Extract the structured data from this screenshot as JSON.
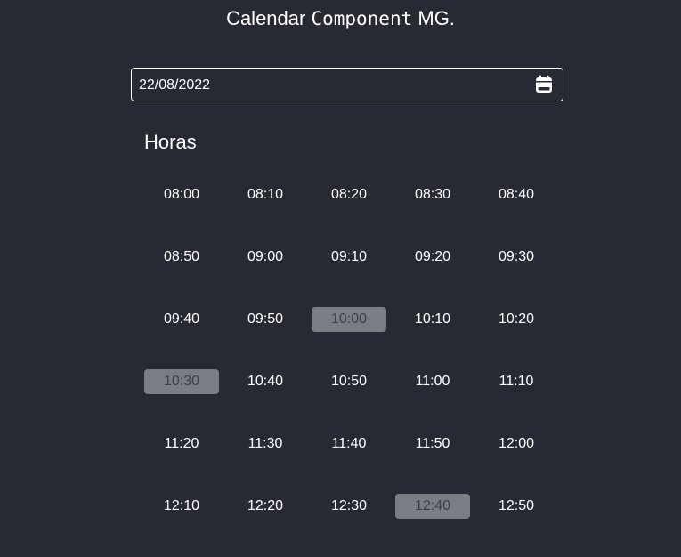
{
  "header": {
    "title_part1": "Calendar ",
    "title_part2": "Component",
    "title_part3": " MG."
  },
  "date_input": {
    "value": "22/08/2022",
    "icon": "calendar-icon"
  },
  "hours": {
    "label": "Horas",
    "slots": [
      {
        "time": "08:00",
        "selected": false
      },
      {
        "time": "08:10",
        "selected": false
      },
      {
        "time": "08:20",
        "selected": false
      },
      {
        "time": "08:30",
        "selected": false
      },
      {
        "time": "08:40",
        "selected": false
      },
      {
        "time": "08:50",
        "selected": false
      },
      {
        "time": "09:00",
        "selected": false
      },
      {
        "time": "09:10",
        "selected": false
      },
      {
        "time": "09:20",
        "selected": false
      },
      {
        "time": "09:30",
        "selected": false
      },
      {
        "time": "09:40",
        "selected": false
      },
      {
        "time": "09:50",
        "selected": false
      },
      {
        "time": "10:00",
        "selected": true
      },
      {
        "time": "10:10",
        "selected": false
      },
      {
        "time": "10:20",
        "selected": false
      },
      {
        "time": "10:30",
        "selected": true
      },
      {
        "time": "10:40",
        "selected": false
      },
      {
        "time": "10:50",
        "selected": false
      },
      {
        "time": "11:00",
        "selected": false
      },
      {
        "time": "11:10",
        "selected": false
      },
      {
        "time": "11:20",
        "selected": false
      },
      {
        "time": "11:30",
        "selected": false
      },
      {
        "time": "11:40",
        "selected": false
      },
      {
        "time": "11:50",
        "selected": false
      },
      {
        "time": "12:00",
        "selected": false
      },
      {
        "time": "12:10",
        "selected": false
      },
      {
        "time": "12:20",
        "selected": false
      },
      {
        "time": "12:30",
        "selected": false
      },
      {
        "time": "12:40",
        "selected": true
      },
      {
        "time": "12:50",
        "selected": false
      }
    ]
  },
  "colors": {
    "background": "#282a33",
    "text": "#ffffff",
    "selected_slot_bg": "#7b7d85",
    "selected_slot_text": "#3c3f48"
  }
}
